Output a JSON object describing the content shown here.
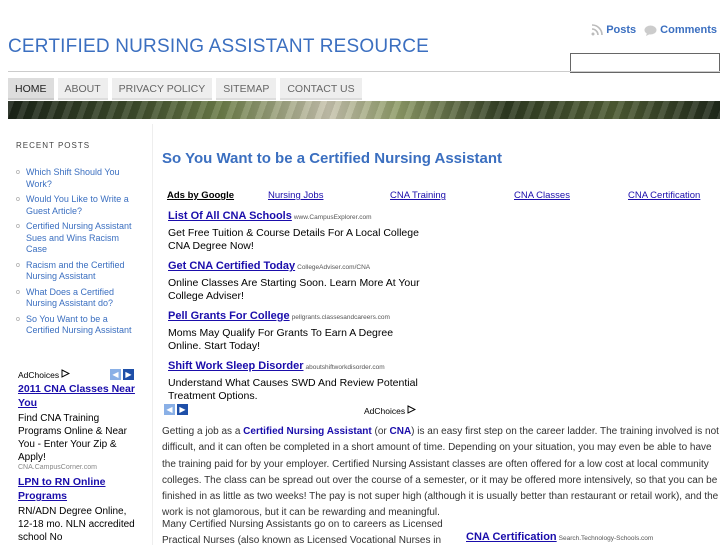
{
  "site": {
    "title": "CERTIFIED NURSING ASSISTANT RESOURCE"
  },
  "feeds": {
    "posts": "Posts",
    "comments": "Comments",
    "posts_icon": "rss-icon",
    "comments_icon": "comment-bubble-icon"
  },
  "search": {
    "placeholder": ""
  },
  "nav": {
    "tabs": [
      "HOME",
      "ABOUT",
      "PRIVACY POLICY",
      "SITEMAP",
      "CONTACT US"
    ]
  },
  "sidebar": {
    "heading": "RECENT POSTS",
    "recent_posts": [
      "Which Shift Should You Work?",
      "Would You Like to Write a Guest Article?",
      "Certified Nursing Assistant Sues and Wins Racism Case",
      "Racism and the Certified Nursing Assistant",
      "What Does a Certified Nursing Assistant do?",
      "So You Want to be a Certified Nursing Assistant"
    ],
    "ad": {
      "adchoices": "AdChoices",
      "ads": [
        {
          "title": "2011 CNA Classes Near You",
          "desc": "Find CNA Training Programs Online & Near You - Enter Your Zip & Apply!",
          "url": "CNA.CampusCorner.com"
        },
        {
          "title": "LPN to RN Online Programs",
          "desc": "RN/ADN Degree Online, 12-18 mo. NLN accredited school No"
        }
      ]
    }
  },
  "post": {
    "title": "So You Want to be a Certified Nursing Assistant",
    "ad_links": {
      "ads_by_google": "Ads by Google",
      "links": [
        "Nursing Jobs",
        "CNA Training",
        "CNA Classes",
        "CNA Certification"
      ]
    },
    "ads": [
      {
        "title": "List Of All CNA Schools",
        "url": "www.CampusExplorer.com",
        "desc": "Get Free Tuition & Course Details For A Local College CNA Degree Now!"
      },
      {
        "title": "Get CNA Certified Today",
        "url": "CollegeAdviser.com/CNA",
        "desc": "Online Classes Are Starting Soon. Learn More At Your College Adviser!"
      },
      {
        "title": "Pell Grants For College",
        "url": "pellgrants.classesandcareers.com",
        "desc": "Moms May Qualify For Grants To Earn A Degree Online. Start Today!"
      },
      {
        "title": "Shift Work Sleep Disorder",
        "url": "aboutshiftworkdisorder.com",
        "desc": "Understand What Causes SWD And Review Potential Treatment Options."
      }
    ],
    "adchoices": "AdChoices",
    "paragraph1": {
      "p1": "Getting a job as a ",
      "link1": "Certified Nursing Assistant",
      "p2": " (or ",
      "link2": "CNA",
      "p3": ") is an easy first step on the career ladder.  The training involved is not difficult, and it can often be completed in a short amount of time.  Depending on your situation, you may even be able to have the training paid for by your employer.  Certified Nursing Assistant classes are often offered for a low cost at local community colleges.  The class can be spread out over the course of a semester, or it may be offered more intensively, so that you can be finished in as little as two weeks!  The pay is not super high (although it is usually better than restaurant or retail work), and the work is not glamorous, but it can be rewarding and meaningful."
    },
    "paragraph2": "Many Certified Nursing Assistants go on to careers as Licensed Practical Nurses  (also known as Licensed Vocational Nurses in",
    "bottom_ad": {
      "title": "CNA Certification",
      "url": "Search.Technology-Schools.com"
    }
  }
}
